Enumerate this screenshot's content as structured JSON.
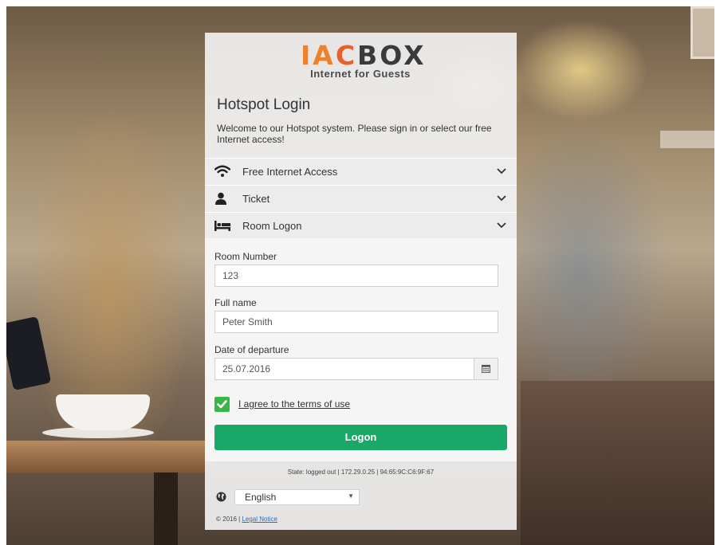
{
  "brand": {
    "logo_ia": "IA",
    "logo_c": "C",
    "logo_box": "BOX",
    "tagline": "Internet for Guests"
  },
  "header": {
    "title": "Hotspot Login",
    "welcome": "Welcome to our Hotspot system. Please sign in or select our free Internet access!"
  },
  "accordion": {
    "items": [
      {
        "label": "Free Internet Access",
        "icon": "wifi-icon"
      },
      {
        "label": "Ticket",
        "icon": "user-icon"
      },
      {
        "label": "Room Logon",
        "icon": "bed-icon"
      }
    ]
  },
  "form": {
    "room_number": {
      "label": "Room Number",
      "value": "123"
    },
    "full_name": {
      "label": "Full name",
      "value": "Peter Smith"
    },
    "departure": {
      "label": "Date of departure",
      "value": "25.07.2016"
    },
    "terms_label": "I agree to the terms of use",
    "terms_checked": true,
    "logon_label": "Logon"
  },
  "status": {
    "state_text": "State: logged out | 172.29.0.25 | 94:65:9C:C6:9F:67"
  },
  "language": {
    "selected": "English"
  },
  "footer": {
    "copyright": "© 2016 |",
    "legal_link": "Legal Notice"
  },
  "colors": {
    "accent": "#19a867",
    "checkbox": "#39b54a",
    "logo_orange": "#f0812b",
    "logo_dark": "#3a3a3a"
  }
}
